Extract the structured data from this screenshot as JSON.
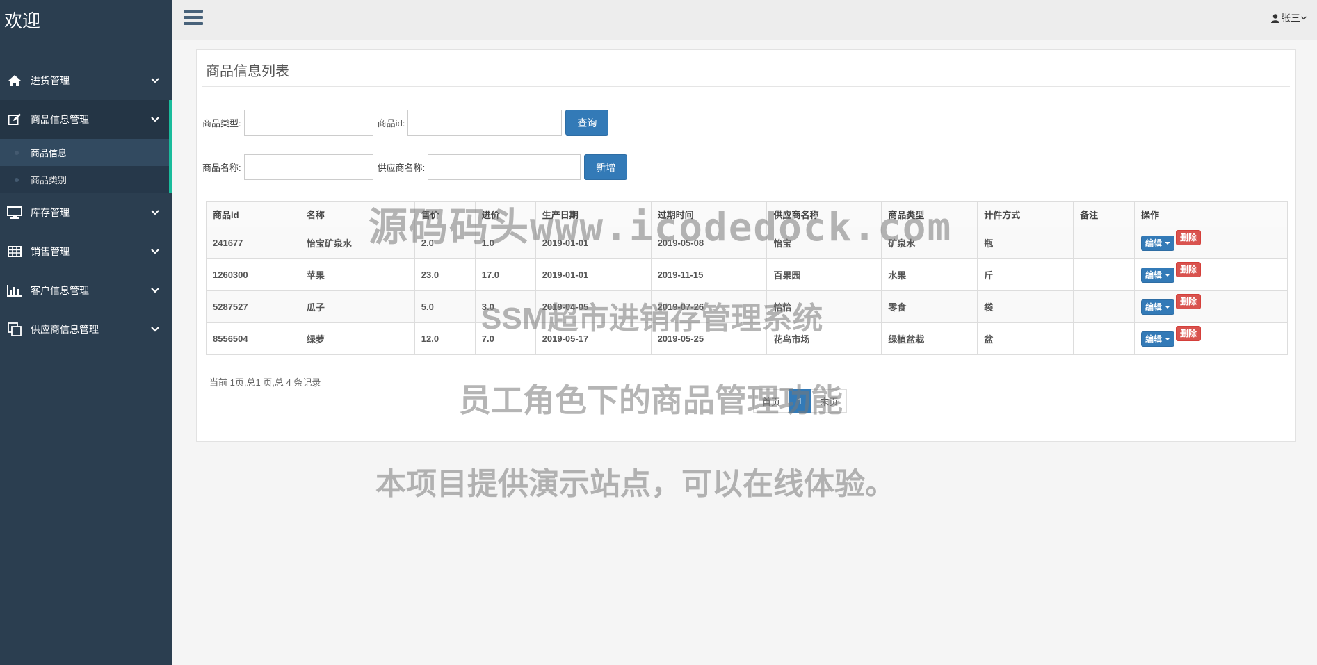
{
  "sidebar": {
    "title": "欢迎",
    "menu": [
      {
        "label": "进货管理",
        "icon": "home-icon"
      },
      {
        "label": "商品信息管理",
        "icon": "edit-icon",
        "active": true,
        "children": [
          {
            "label": "商品信息",
            "active": true
          },
          {
            "label": "商品类别"
          }
        ]
      },
      {
        "label": "库存管理",
        "icon": "monitor-icon"
      },
      {
        "label": "销售管理",
        "icon": "table-icon"
      },
      {
        "label": "客户信息管理",
        "icon": "bar-chart-icon"
      },
      {
        "label": "供应商信息管理",
        "icon": "copy-icon"
      }
    ],
    "accent_color": "#1abc9c",
    "background": "#2b3e50"
  },
  "topbar": {
    "user_name": "张三"
  },
  "panel": {
    "title": "商品信息列表",
    "search": {
      "type_label": "商品类型:",
      "type_value": "",
      "id_label": "商品id:",
      "id_value": "",
      "query_button": "查询",
      "name_label": "商品名称:",
      "name_value": "",
      "supplier_label": "供应商名称:",
      "supplier_value": "",
      "add_button": "新增"
    },
    "table": {
      "headers": [
        "商品id",
        "名称",
        "售价",
        "进价",
        "生产日期",
        "过期时间",
        "供应商名称",
        "商品类型",
        "计件方式",
        "备注",
        "操作"
      ],
      "rows": [
        [
          "241677",
          "怡宝矿泉水",
          "2.0",
          "1.0",
          "2019-01-01",
          "2019-05-08",
          "怡宝",
          "矿泉水",
          "瓶",
          ""
        ],
        [
          "1260300",
          "苹果",
          "23.0",
          "17.0",
          "2019-01-01",
          "2019-11-15",
          "百果园",
          "水果",
          "斤",
          ""
        ],
        [
          "5287527",
          "瓜子",
          "5.0",
          "3.0",
          "2019-04-05",
          "2019-07-26",
          "恰恰",
          "零食",
          "袋",
          ""
        ],
        [
          "8556504",
          "绿萝",
          "12.0",
          "7.0",
          "2019-05-17",
          "2019-05-25",
          "花鸟市场",
          "绿植盆栽",
          "盆",
          ""
        ]
      ],
      "edit_label": "编辑",
      "delete_label": "删除"
    },
    "pagination": {
      "info": "当前 1页,总1 页,总 4 条记录",
      "first": "首页",
      "current": "1",
      "last": "末页"
    }
  },
  "watermarks": [
    "源码码头www.icodedock.com",
    "SSM超市进销存管理系统",
    "员工角色下的商品管理功能",
    "本项目提供演示站点，可以在线体验。"
  ],
  "colors": {
    "primary": "#337ab7",
    "danger": "#d9534f"
  }
}
